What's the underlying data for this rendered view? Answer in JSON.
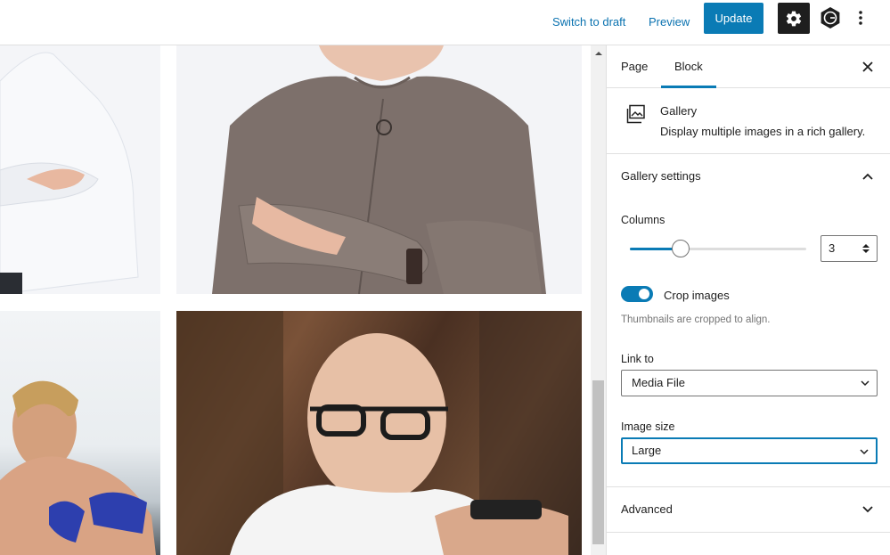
{
  "topbar": {
    "switch_to_draft": "Switch to draft",
    "preview": "Preview",
    "update": "Update",
    "icons": [
      "gear-icon",
      "g-logo-icon",
      "more-vertical-icon"
    ]
  },
  "sidebar": {
    "tabs": [
      "Page",
      "Block"
    ],
    "active_tab": "Block",
    "block": {
      "icon": "gallery-icon",
      "title": "Gallery",
      "description": "Display multiple images in a rich gallery."
    },
    "gallery_settings": {
      "title": "Gallery settings",
      "columns_label": "Columns",
      "columns_value": "3",
      "columns_slider_fraction": 0.29,
      "crop_label": "Crop images",
      "crop_enabled": true,
      "crop_help": "Thumbnails are cropped to align.",
      "link_to_label": "Link to",
      "link_to_value": "Media File",
      "image_size_label": "Image size",
      "image_size_value": "Large"
    },
    "advanced_title": "Advanced"
  },
  "colors": {
    "accent": "#0a7bb5",
    "link": "#0a72b0",
    "dark": "#1e1e1e",
    "help_text": "#757575"
  }
}
